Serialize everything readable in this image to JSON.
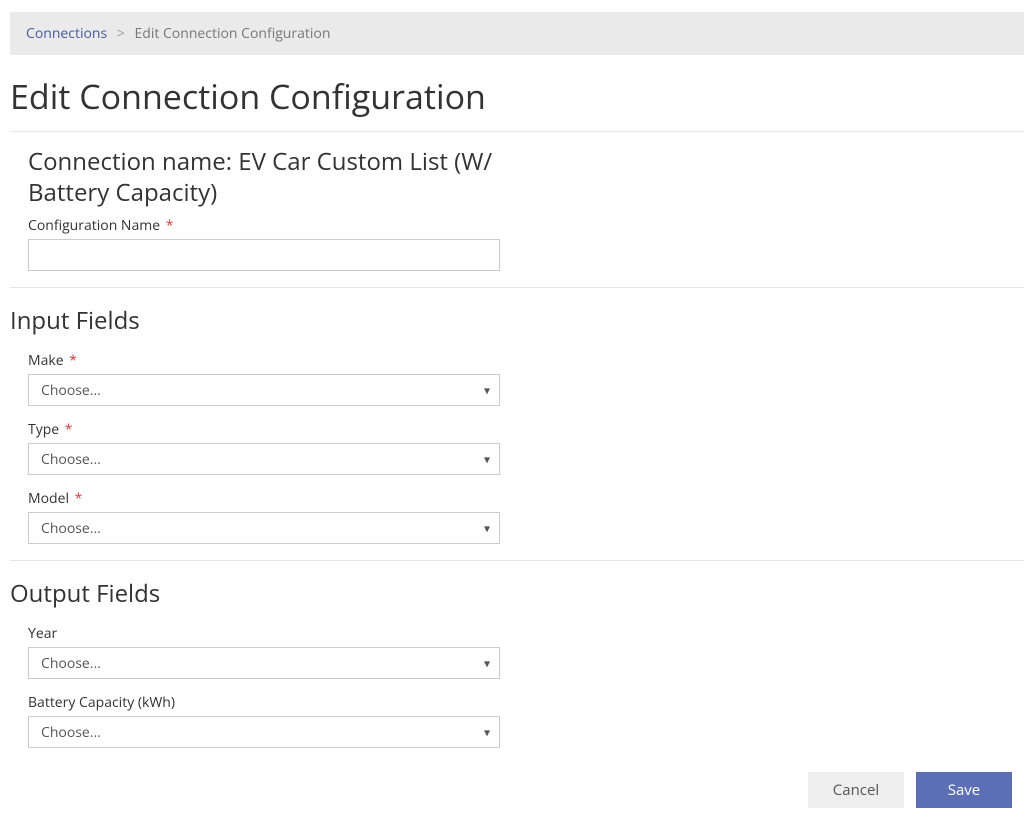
{
  "breadcrumb": {
    "root": "Connections",
    "separator": ">",
    "current": "Edit Connection Configuration"
  },
  "page": {
    "title": "Edit Connection Configuration"
  },
  "connection": {
    "heading_prefix": "Connection name: ",
    "name": "EV Car Custom List (W/ Battery Capacity)"
  },
  "config_name": {
    "label": "Configuration Name",
    "required": "*",
    "value": ""
  },
  "input_fields": {
    "heading": "Input Fields",
    "items": [
      {
        "label": "Make",
        "required": "*",
        "selected": "Choose..."
      },
      {
        "label": "Type",
        "required": "*",
        "selected": "Choose..."
      },
      {
        "label": "Model",
        "required": "*",
        "selected": "Choose..."
      }
    ]
  },
  "output_fields": {
    "heading": "Output Fields",
    "items": [
      {
        "label": "Year",
        "selected": "Choose..."
      },
      {
        "label": "Battery Capacity (kWh)",
        "selected": "Choose..."
      }
    ]
  },
  "actions": {
    "cancel": "Cancel",
    "save": "Save"
  }
}
